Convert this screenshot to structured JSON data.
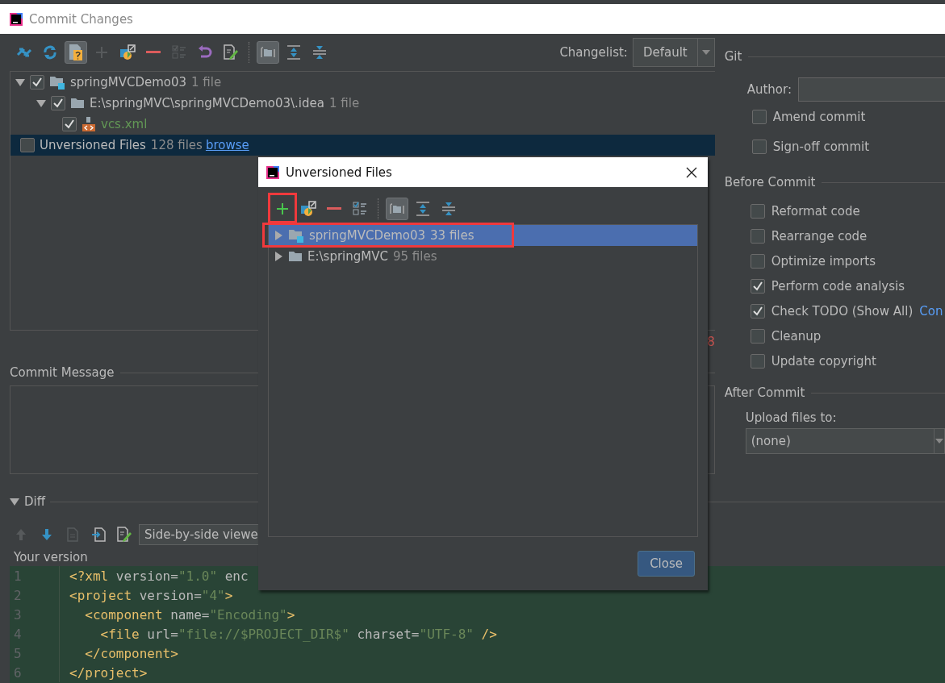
{
  "window": {
    "title": "Commit Changes"
  },
  "toolbar": [
    {
      "kind": "diff",
      "on": false,
      "disabled": false
    },
    {
      "kind": "refresh",
      "on": false,
      "disabled": false
    },
    {
      "kind": "unversioned",
      "on": true,
      "disabled": false
    },
    {
      "kind": "add",
      "on": false,
      "disabled": true
    },
    {
      "kind": "move",
      "on": false,
      "disabled": false
    },
    {
      "kind": "remove",
      "on": false,
      "disabled": false
    },
    {
      "kind": "checklist",
      "on": false,
      "disabled": true
    },
    {
      "kind": "undo",
      "on": false,
      "disabled": false
    },
    {
      "kind": "edit",
      "on": false,
      "disabled": false
    },
    {
      "kind": "group",
      "on": true,
      "disabled": false
    },
    {
      "kind": "expand",
      "on": false,
      "disabled": false
    },
    {
      "kind": "collapse",
      "on": false,
      "disabled": false
    }
  ],
  "changelist": {
    "label": "Changelist:",
    "value": "Default"
  },
  "tree": [
    {
      "kind": "module",
      "label": "springMVCDemo03",
      "count": "1 file",
      "checked": true,
      "expanded": true,
      "selected": false,
      "children": [
        {
          "kind": "folder",
          "label": "E:\\springMVC\\springMVCDemo03\\.idea",
          "count": "1 file",
          "checked": true,
          "expanded": true,
          "selected": false,
          "children": [
            {
              "kind": "xml",
              "label": "vcs.xml",
              "checked": true,
              "selected": false
            }
          ]
        }
      ]
    },
    {
      "kind": "plain",
      "label": "Unversioned Files",
      "count": "128 files",
      "link": "browse",
      "checked": false,
      "selected": true
    }
  ],
  "stray_number": "8",
  "commit_message": {
    "label": "Commit Message"
  },
  "diff": {
    "label": "Diff",
    "expanded": true,
    "toolbar": [
      {
        "kind": "up",
        "disabled": true
      },
      {
        "kind": "down",
        "disabled": false
      },
      {
        "kind": "doc",
        "disabled": true
      },
      {
        "kind": "import",
        "disabled": false
      },
      {
        "kind": "edit",
        "disabled": false
      }
    ],
    "viewer": "Side-by-side viewe",
    "caption": "Your version",
    "lines": [
      {
        "number": "1",
        "tokens": [
          {
            "kind": "tag",
            "text": "<?xml"
          },
          {
            "kind": "attr",
            "text": " version="
          },
          {
            "kind": "value",
            "text": "\"1.0\""
          },
          {
            "kind": "attr",
            "text": " enc"
          }
        ]
      },
      {
        "number": "2",
        "tokens": [
          {
            "kind": "tag",
            "text": "<project"
          },
          {
            "kind": "attr",
            "text": " version="
          },
          {
            "kind": "value",
            "text": "\"4\""
          },
          {
            "kind": "tag",
            "text": ">"
          }
        ]
      },
      {
        "number": "3",
        "tokens": [
          {
            "kind": "tag",
            "text": "  <component"
          },
          {
            "kind": "attr",
            "text": " name="
          },
          {
            "kind": "value",
            "text": "\"Encoding\""
          },
          {
            "kind": "tag",
            "text": ">"
          }
        ]
      },
      {
        "number": "4",
        "tokens": [
          {
            "kind": "tag",
            "text": "    <file"
          },
          {
            "kind": "attr",
            "text": " url="
          },
          {
            "kind": "value",
            "text": "\"file://$PROJECT_DIR$\""
          },
          {
            "kind": "attr",
            "text": " charset="
          },
          {
            "kind": "value",
            "text": "\"UTF-8\""
          },
          {
            "kind": "tag",
            "text": " />"
          }
        ]
      },
      {
        "number": "5",
        "tokens": [
          {
            "kind": "tag",
            "text": "  </component>"
          }
        ]
      },
      {
        "number": "6",
        "tokens": [
          {
            "kind": "tag",
            "text": "</project>"
          }
        ]
      }
    ]
  },
  "git": {
    "title": "Git",
    "author_label": "Author:",
    "options": [
      {
        "label": "Amend commit",
        "checked": false
      },
      {
        "label": "Sign-off commit",
        "checked": false
      }
    ]
  },
  "before_commit": {
    "title": "Before Commit",
    "options": [
      {
        "label": "Reformat code",
        "checked": false
      },
      {
        "label": "Rearrange code",
        "checked": false
      },
      {
        "label": "Optimize imports",
        "checked": false
      },
      {
        "label": "Perform code analysis",
        "checked": true
      },
      {
        "label": "Check TODO (Show All)",
        "checked": true,
        "link": "Con"
      },
      {
        "label": "Cleanup",
        "checked": false
      },
      {
        "label": "Update copyright",
        "checked": false
      }
    ]
  },
  "after_commit": {
    "title": "After Commit",
    "upload_label": "Upload files to:",
    "upload_value": "(none)"
  },
  "dialog": {
    "title": "Unversioned Files",
    "toolbar": [
      {
        "kind": "add",
        "on": false
      },
      {
        "kind": "move",
        "on": false
      },
      {
        "kind": "remove",
        "on": false
      },
      {
        "kind": "checklist",
        "on": false
      },
      {
        "kind": "group",
        "on": true
      },
      {
        "kind": "expand",
        "on": false
      },
      {
        "kind": "collapse",
        "on": false
      }
    ],
    "tree": [
      {
        "kind": "module",
        "label": "springMVCDemo03",
        "count": "33 files",
        "expanded": false,
        "selected": true
      },
      {
        "kind": "folder",
        "label": "E:\\springMVC",
        "count": "95 files",
        "expanded": false,
        "selected": false
      }
    ],
    "close": "Close"
  }
}
